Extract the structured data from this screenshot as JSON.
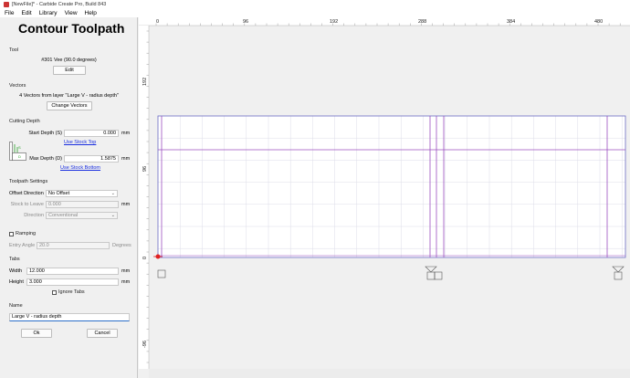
{
  "window": {
    "title": "[NewFile]* - Carbide Create Pro, Build 843"
  },
  "menu": [
    "File",
    "Edit",
    "Library",
    "View",
    "Help"
  ],
  "panel": {
    "title": "Contour Toolpath",
    "tool": {
      "heading": "Tool",
      "name": "#301 Vee (90.0 degrees)",
      "edit_label": "Edit"
    },
    "vectors": {
      "heading": "Vectors",
      "summary": "4 Vectors from layer \"Large V - radius depth\"",
      "change_label": "Change Vectors"
    },
    "cutting_depth": {
      "heading": "Cutting Depth",
      "start_label": "Start Depth (S)",
      "start_value": "0.000",
      "start_unit": "mm",
      "use_stock_top": "Use Stock Top",
      "max_label": "Max Depth (D)",
      "max_value": "1.5875",
      "max_unit": "mm",
      "use_stock_bottom": "Use Stock Bottom"
    },
    "toolpath_settings": {
      "heading": "Toolpath Settings",
      "offset_label": "Offset Direction",
      "offset_value": "No Offset",
      "stock_label": "Stock to Leave",
      "stock_value": "0.000",
      "stock_unit": "mm",
      "direction_label": "Direction",
      "direction_value": "Conventional"
    },
    "ramping": {
      "label": "Ramping",
      "checked": false,
      "entry_label": "Entry Angle",
      "entry_value": "20.0",
      "entry_unit": "Degrees"
    },
    "tabs": {
      "heading": "Tabs",
      "width_label": "Width",
      "width_value": "12.000",
      "width_unit": "mm",
      "height_label": "Height",
      "height_value": "3.000",
      "height_unit": "mm",
      "ignore_label": "Ignore Tabs",
      "ignore_checked": false
    },
    "name": {
      "heading": "Name",
      "value": "Large V - radius depth"
    },
    "ok_label": "Ok",
    "cancel_label": "Cancel"
  },
  "canvas": {
    "ruler_x_labels": [
      "0",
      "96",
      "192",
      "288",
      "384",
      "480"
    ],
    "ruler_y_labels": [
      "192",
      "96",
      "0",
      "-96"
    ],
    "colors": {
      "stock_outline": "#6c6cc4",
      "vector_line": "#9b4fbf",
      "grid": "#dcdce8",
      "origin": "#e02020"
    }
  }
}
